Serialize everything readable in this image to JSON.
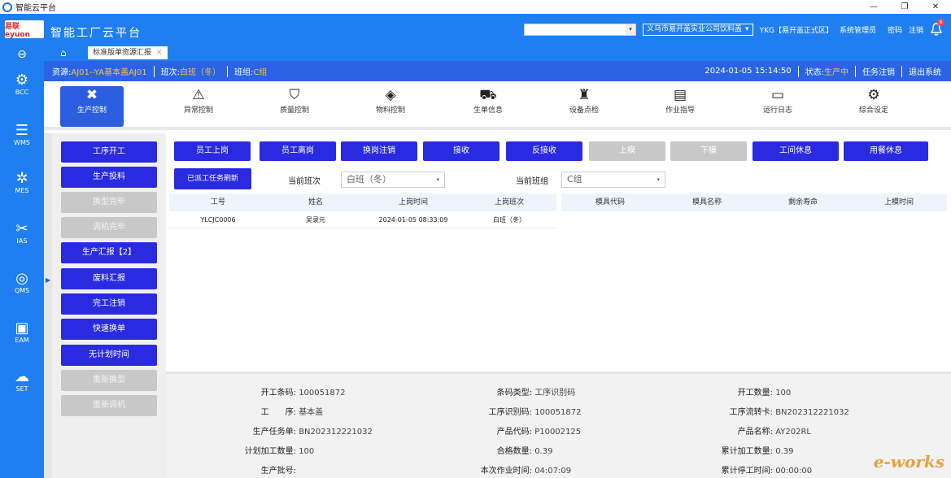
{
  "window": {
    "title": "智能云平台",
    "controls": [
      "—",
      "❐",
      "✕"
    ]
  },
  "header": {
    "logo_text": "易联 eyuon",
    "app_title": "智能工厂云平台",
    "company_select": "义乌市易开盖实业公司饮料盖",
    "env_label": "YKG【易开盖正式区】",
    "user_label": "系统管理员",
    "password_link": "密码",
    "logout_link": "注销",
    "bell_badge": "6"
  },
  "leftnav": {
    "items": [
      {
        "icon": "back-circle-icon",
        "label": ""
      },
      {
        "icon": "gear-cluster-icon",
        "label": "BCC"
      },
      {
        "icon": "database-icon",
        "label": "WMS"
      },
      {
        "icon": "cog-icon",
        "label": "MES"
      },
      {
        "icon": "tools-icon",
        "label": "IAS"
      },
      {
        "icon": "shield-q-icon",
        "label": "QMS"
      },
      {
        "icon": "doc-icon",
        "label": "EAM"
      },
      {
        "icon": "cloud-gear-icon",
        "label": "SET"
      }
    ]
  },
  "tabs": {
    "active_tab": "标准版单资源汇报",
    "close": "✕"
  },
  "infobar": {
    "resource_label": "资源:",
    "resource_value": "AJ01--YA基本盖AJ01",
    "shift_label": "班次:",
    "shift_value": "白班（冬）",
    "team_label": "班组:",
    "team_value": "C组",
    "datetime": "2024-01-05 15:14:50",
    "status_label": "状态:",
    "status_value": "生产中",
    "task_logout": "任务注销",
    "exit": "退出系统"
  },
  "topicons": [
    {
      "icon": "tools-cross-icon",
      "label": "生产控制",
      "active": true
    },
    {
      "icon": "alarm-icon",
      "label": "异常控制",
      "active": false
    },
    {
      "icon": "shield-check-icon",
      "label": "质量控制",
      "active": false
    },
    {
      "icon": "box-icon",
      "label": "物料控制",
      "active": false
    },
    {
      "icon": "cart-icon",
      "label": "生单信息",
      "active": false
    },
    {
      "icon": "worker-icon",
      "label": "设备点检",
      "active": false
    },
    {
      "icon": "clipboard-icon",
      "label": "作业指导",
      "active": false
    },
    {
      "icon": "monitor-icon",
      "label": "运行日志",
      "active": false
    },
    {
      "icon": "settings-icon",
      "label": "综合设定",
      "active": false
    }
  ],
  "sidebar": {
    "buttons": [
      {
        "label": "工序开工",
        "enabled": true
      },
      {
        "label": "生产投料",
        "enabled": true
      },
      {
        "label": "换型完毕",
        "enabled": false
      },
      {
        "label": "调机完毕",
        "enabled": false
      },
      {
        "label": "生产汇报【2】",
        "enabled": true
      },
      {
        "label": "废料汇报",
        "enabled": true
      },
      {
        "label": "完工注销",
        "enabled": true
      },
      {
        "label": "快速换单",
        "enabled": true
      },
      {
        "label": "无计划时间",
        "enabled": true
      },
      {
        "label": "重新换型",
        "enabled": false
      },
      {
        "label": "重新调机",
        "enabled": false
      }
    ]
  },
  "actions": [
    {
      "label": "员工上岗",
      "enabled": true
    },
    {
      "label": "员工离岗",
      "enabled": true
    },
    {
      "label": "换岗注销",
      "enabled": true
    },
    {
      "label": "接收",
      "enabled": true
    },
    {
      "label": "反接收",
      "enabled": true
    },
    {
      "label": "上模",
      "enabled": false
    },
    {
      "label": "下模",
      "enabled": false
    },
    {
      "label": "工间休息",
      "enabled": true
    },
    {
      "label": "用餐休息",
      "enabled": true
    }
  ],
  "refresh_button": "已派工任务刷新",
  "current_shift": {
    "label": "当前班次",
    "value": "白班（冬）"
  },
  "current_team": {
    "label": "当前班组",
    "value": "C组"
  },
  "employee_table": {
    "columns": [
      "工号",
      "姓名",
      "上岗时间",
      "上岗班次"
    ],
    "rows": [
      [
        "YLCJC0006",
        "吴录元",
        "2024-01-05 08:33:09",
        "白班（冬）"
      ]
    ]
  },
  "mold_table": {
    "columns": [
      "模具代码",
      "模具名称",
      "剩余寿命",
      "上模时间"
    ]
  },
  "details": {
    "start_code_k": "开工条码:",
    "start_code_v": "100051872",
    "code_type_k": "条码类型:",
    "code_type_v": "工序识别码",
    "start_qty_k": "开工数量:",
    "start_qty_v": "100",
    "process_k": "工　　序:",
    "process_v": "基本盖",
    "process_code_k": "工序识别码:",
    "process_code_v": "100051872",
    "flow_card_k": "工序流转卡:",
    "flow_card_v": "BN202312221032",
    "task_k": "生产任务单:",
    "task_v": "BN202312221032",
    "product_code_k": "产品代码:",
    "product_code_v": "P10002125",
    "product_name_k": "产品名称:",
    "product_name_v": "AY202RL",
    "plan_qty_k": "计划加工数量:",
    "plan_qty_v": "100",
    "ok_qty_k": "合格数量:",
    "ok_qty_v": "0.39",
    "acc_qty_k": "累计加工数量:",
    "acc_qty_v": "0.39",
    "batch_k": "生产批号:",
    "batch_v": "",
    "op_time_k": "本次作业时间:",
    "op_time_v": "04:07:09",
    "stop_time_k": "累计停工时间:",
    "stop_time_v": "00:00:00"
  },
  "watermark": "e-works"
}
